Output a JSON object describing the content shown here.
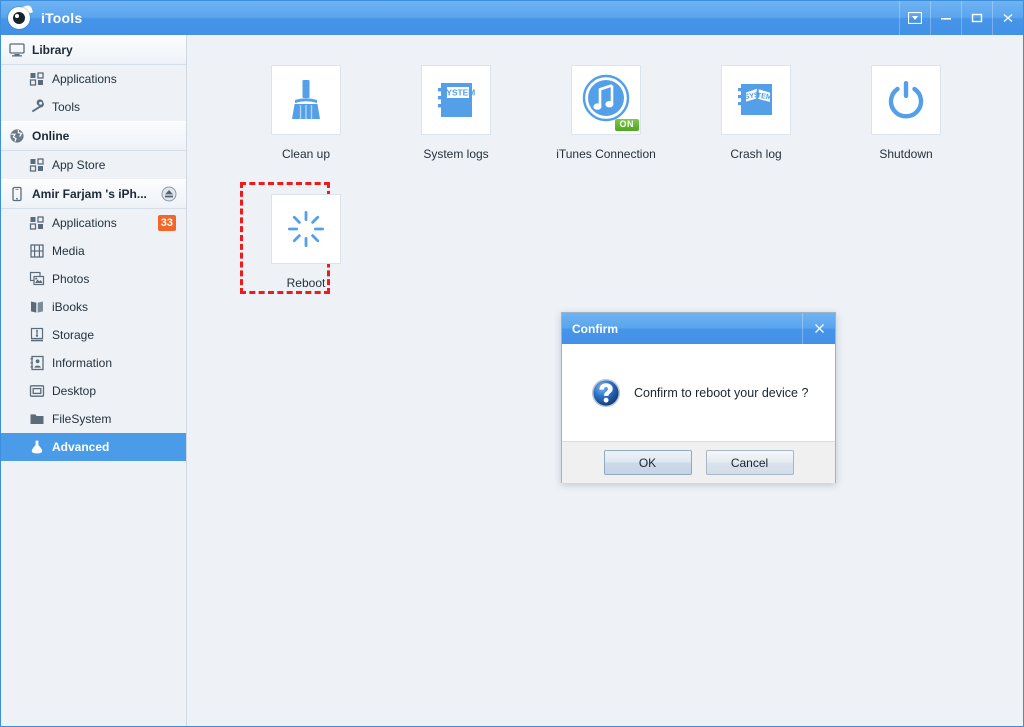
{
  "window": {
    "title": "iTools",
    "logo_icon": "itools-eye-logo",
    "buttons": [
      {
        "name": "collapse-button",
        "icon": "boxed-down-arrow-icon"
      },
      {
        "name": "minimize-button",
        "icon": "minimize-icon"
      },
      {
        "name": "maximize-button",
        "icon": "maximize-icon"
      },
      {
        "name": "close-button",
        "icon": "close-icon"
      }
    ]
  },
  "sidebar": {
    "sections": [
      {
        "header": {
          "label": "Library",
          "icon": "monitor-icon"
        },
        "items": [
          {
            "label": "Applications",
            "icon": "grid-apps-icon"
          },
          {
            "label": "Tools",
            "icon": "wrench-icon"
          }
        ]
      },
      {
        "header": {
          "label": "Online",
          "icon": "globe-icon"
        },
        "items": [
          {
            "label": "App Store",
            "icon": "grid-apps-icon"
          }
        ]
      },
      {
        "header": {
          "label": "Amir Farjam 's iPh...",
          "icon": "iphone-icon",
          "eject_icon": "eject-icon"
        },
        "items": [
          {
            "label": "Applications",
            "icon": "grid-apps-icon",
            "badge": "33"
          },
          {
            "label": "Media",
            "icon": "film-icon"
          },
          {
            "label": "Photos",
            "icon": "photos-icon"
          },
          {
            "label": "iBooks",
            "icon": "book-icon"
          },
          {
            "label": "Storage",
            "icon": "usb-storage-icon"
          },
          {
            "label": "Information",
            "icon": "contact-card-icon"
          },
          {
            "label": "Desktop",
            "icon": "desktop-icon"
          },
          {
            "label": "FileSystem",
            "icon": "folder-icon"
          },
          {
            "label": "Advanced",
            "icon": "flask-icon",
            "selected": true
          }
        ]
      }
    ]
  },
  "main": {
    "tiles": [
      {
        "label": "Clean up",
        "icon": "broom-icon"
      },
      {
        "label": "System logs",
        "icon": "system-notebook-icon"
      },
      {
        "label": "iTunes Connection",
        "icon": "itunes-note-icon",
        "badge": "ON"
      },
      {
        "label": "Crash log",
        "icon": "crash-notebook-icon"
      },
      {
        "label": "Shutdown",
        "icon": "power-icon"
      },
      {
        "label": "Reboot",
        "icon": "spinner-icon",
        "annotated": true
      }
    ]
  },
  "dialog": {
    "title": "Confirm",
    "close_icon": "close-icon",
    "icon": "question-mark-icon",
    "message": "Confirm to reboot your device ?",
    "ok_label": "OK",
    "cancel_label": "Cancel"
  },
  "colors": {
    "titlebar_blue": "#4795e9",
    "accent_blue": "#4a9ce8",
    "icon_blue": "#53a0e8",
    "badge_orange": "#f4652a",
    "badge_green": "#4da61f",
    "annotation_red": "#ee1b1b",
    "content_bg": "#eef2f7"
  }
}
